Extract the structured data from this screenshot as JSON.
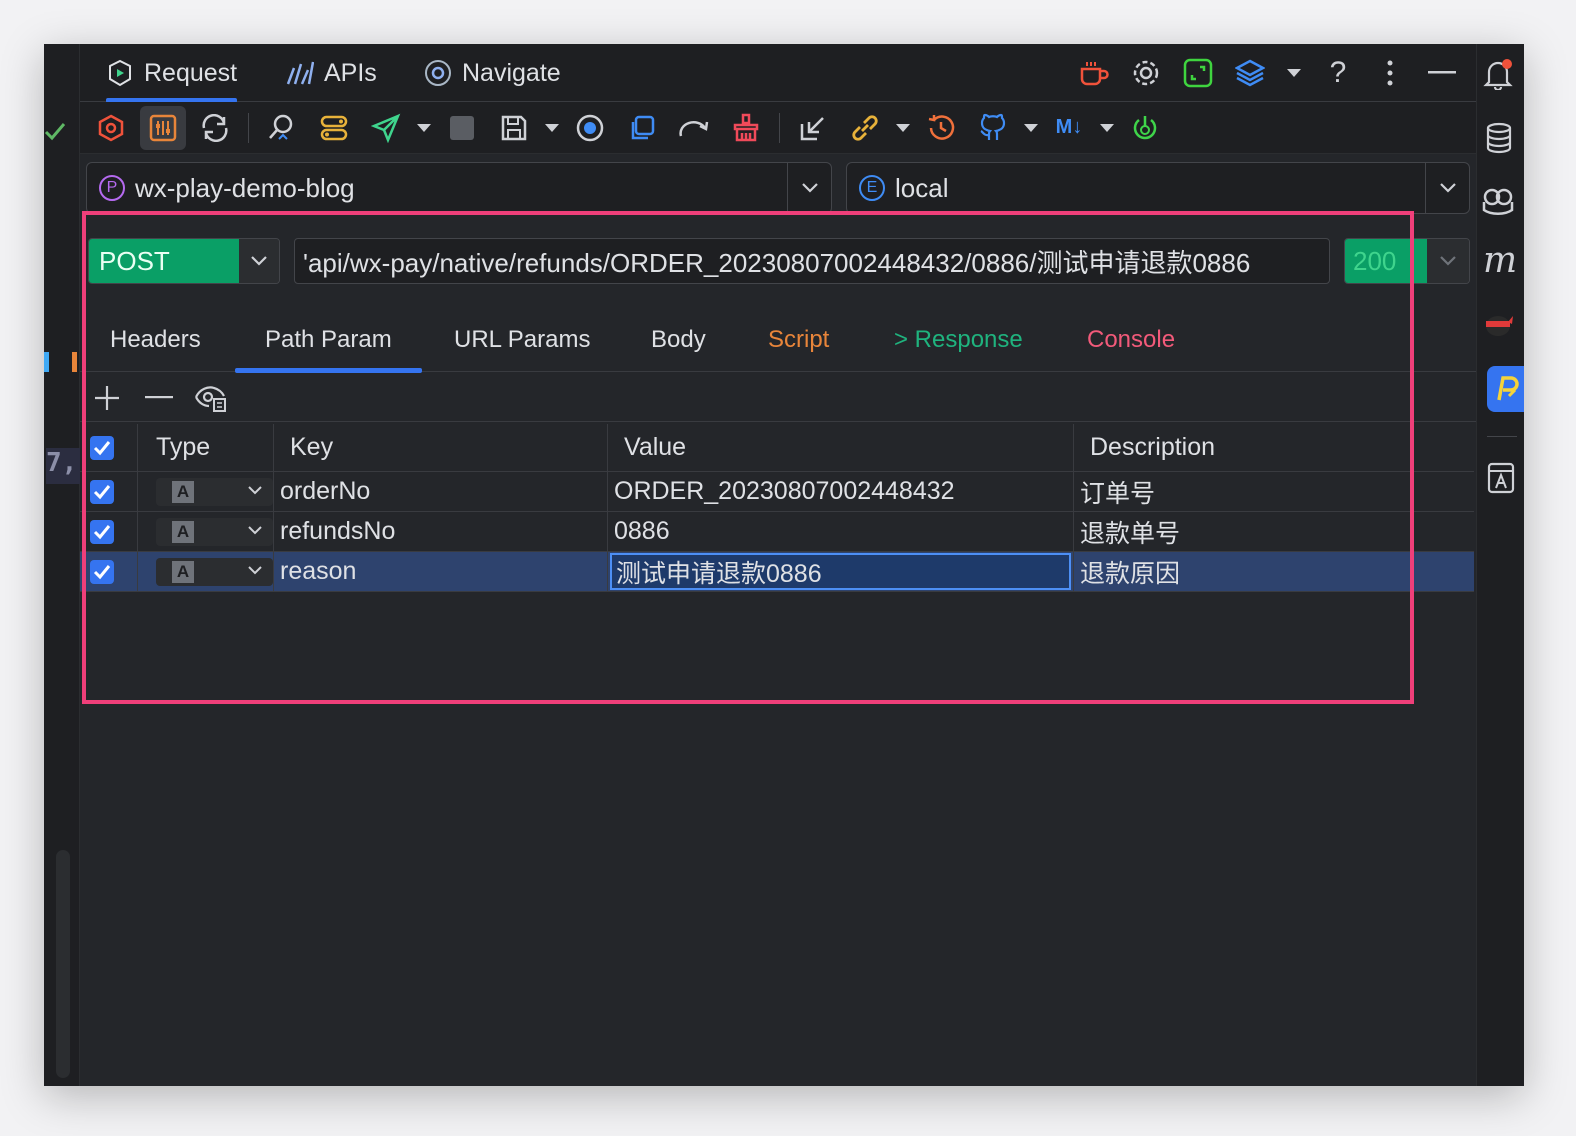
{
  "tabs": [
    {
      "label": "Request",
      "icon": "request-icon",
      "active": true
    },
    {
      "label": "APIs",
      "icon": "apis-icon",
      "active": false
    },
    {
      "label": "Navigate",
      "icon": "navigate-icon",
      "active": false
    }
  ],
  "top_actions": [
    "coffee-icon",
    "gear-icon",
    "expand-icon",
    "layers-icon",
    "help-icon",
    "more-icon",
    "minimize-icon"
  ],
  "top_help": "?",
  "toolbar_icons": [
    "hexagon-icon",
    "sliders-icon",
    "sync-icon",
    "search-code-icon",
    "toggle-icon",
    "send-icon",
    "stop-icon",
    "save-icon",
    "record-icon",
    "copy-icon",
    "redo-icon",
    "clean-icon",
    "import-icon",
    "link-icon",
    "history-icon",
    "github-icon",
    "markdown-icon",
    "power-icon"
  ],
  "toolbar_markdown": "M↓",
  "project": {
    "badge": "P",
    "name": "wx-play-demo-blog"
  },
  "environment": {
    "badge": "E",
    "name": "local"
  },
  "request": {
    "method": "POST",
    "url": "'api/wx-pay/native/refunds/ORDER_20230807002448432/0886/测试申请退款0886",
    "status": "200"
  },
  "subtabs": [
    {
      "label": "Headers",
      "color": "#dfe1e5",
      "active": false
    },
    {
      "label": "Path Param",
      "color": "#dfe1e5",
      "active": true
    },
    {
      "label": "URL Params",
      "color": "#dfe1e5",
      "active": false
    },
    {
      "label": "Body",
      "color": "#dfe1e5",
      "active": false
    },
    {
      "label": "Script",
      "color": "#e8853a",
      "active": false
    },
    {
      "label": "> Response",
      "color": "#1fb37e",
      "active": false
    },
    {
      "label": "Console",
      "color": "#f25a7a",
      "active": false
    }
  ],
  "table": {
    "columns": {
      "type": "Type",
      "key": "Key",
      "value": "Value",
      "description": "Description"
    },
    "type_glyph": "A",
    "rows": [
      {
        "checked": true,
        "key": "orderNo",
        "value": "ORDER_20230807002448432",
        "description": "订单号",
        "selected": false
      },
      {
        "checked": true,
        "key": "refundsNo",
        "value": "0886",
        "description": "退款单号",
        "selected": false
      },
      {
        "checked": true,
        "key": "reason",
        "value": "测试申请退款0886",
        "description": "退款原因",
        "selected": true
      }
    ]
  },
  "right_bar_icons": [
    "notification-icon",
    "database-icon",
    "copilot-icon",
    "m-plugin-icon",
    "ninja-icon",
    "api-plugin-icon",
    "translate-icon"
  ],
  "right_bar_m": "m",
  "gutter_text": "7,",
  "colors": {
    "accent": "#3574f0",
    "method_bg": "#0a9f66",
    "highlight": "#ef3f7a"
  }
}
